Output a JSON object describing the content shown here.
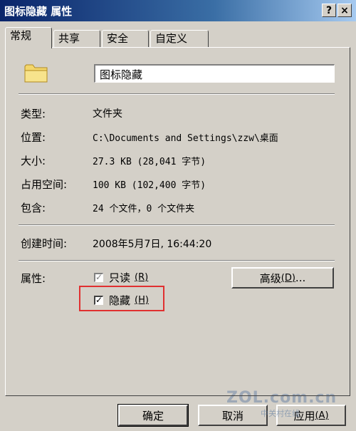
{
  "window": {
    "title": "图标隐藏 属性",
    "help_label": "?",
    "close_label": "×"
  },
  "tabs": [
    {
      "label": "常规"
    },
    {
      "label": "共享"
    },
    {
      "label": "安全"
    },
    {
      "label": "自定义"
    }
  ],
  "general": {
    "folder_name": "图标隐藏",
    "type_label": "类型:",
    "type_value": "文件夹",
    "location_label": "位置:",
    "location_value": "C:\\Documents and Settings\\zzw\\桌面",
    "size_label": "大小:",
    "size_value": "27.3 KB (28,041 字节)",
    "size_on_disk_label": "占用空间:",
    "size_on_disk_value": "100 KB (102,400 字节)",
    "contains_label": "包含:",
    "contains_value": "24 个文件，0 个文件夹",
    "created_label": "创建时间:",
    "created_value": "2008年5月7日, 16:44:20",
    "attributes_label": "属性:",
    "readonly_label": "只读",
    "readonly_key": "(R)",
    "hidden_label": "隐藏",
    "hidden_key": "(H)",
    "advanced_label": "高级",
    "advanced_key": "(D)",
    "advanced_suffix": "..."
  },
  "buttons": {
    "ok": "确定",
    "cancel": "取消",
    "apply": "应用",
    "apply_key": "(A)"
  },
  "watermark": {
    "text": "ZOL.com.cn",
    "subtext": "中关村在线"
  },
  "colors": {
    "titlebar": "#0a246a",
    "face": "#d4d0c8",
    "highlight_box": "#e03030"
  }
}
